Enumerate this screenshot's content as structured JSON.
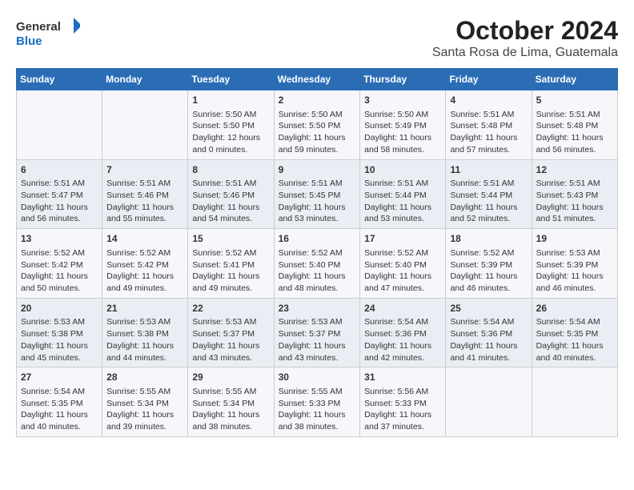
{
  "logo": {
    "line1": "General",
    "line2": "Blue"
  },
  "title": "October 2024",
  "subtitle": "Santa Rosa de Lima, Guatemala",
  "header_days": [
    "Sunday",
    "Monday",
    "Tuesday",
    "Wednesday",
    "Thursday",
    "Friday",
    "Saturday"
  ],
  "weeks": [
    [
      {
        "day": "",
        "content": ""
      },
      {
        "day": "",
        "content": ""
      },
      {
        "day": "1",
        "content": "Sunrise: 5:50 AM\nSunset: 5:50 PM\nDaylight: 12 hours\nand 0 minutes."
      },
      {
        "day": "2",
        "content": "Sunrise: 5:50 AM\nSunset: 5:50 PM\nDaylight: 11 hours\nand 59 minutes."
      },
      {
        "day": "3",
        "content": "Sunrise: 5:50 AM\nSunset: 5:49 PM\nDaylight: 11 hours\nand 58 minutes."
      },
      {
        "day": "4",
        "content": "Sunrise: 5:51 AM\nSunset: 5:48 PM\nDaylight: 11 hours\nand 57 minutes."
      },
      {
        "day": "5",
        "content": "Sunrise: 5:51 AM\nSunset: 5:48 PM\nDaylight: 11 hours\nand 56 minutes."
      }
    ],
    [
      {
        "day": "6",
        "content": "Sunrise: 5:51 AM\nSunset: 5:47 PM\nDaylight: 11 hours\nand 56 minutes."
      },
      {
        "day": "7",
        "content": "Sunrise: 5:51 AM\nSunset: 5:46 PM\nDaylight: 11 hours\nand 55 minutes."
      },
      {
        "day": "8",
        "content": "Sunrise: 5:51 AM\nSunset: 5:46 PM\nDaylight: 11 hours\nand 54 minutes."
      },
      {
        "day": "9",
        "content": "Sunrise: 5:51 AM\nSunset: 5:45 PM\nDaylight: 11 hours\nand 53 minutes."
      },
      {
        "day": "10",
        "content": "Sunrise: 5:51 AM\nSunset: 5:44 PM\nDaylight: 11 hours\nand 53 minutes."
      },
      {
        "day": "11",
        "content": "Sunrise: 5:51 AM\nSunset: 5:44 PM\nDaylight: 11 hours\nand 52 minutes."
      },
      {
        "day": "12",
        "content": "Sunrise: 5:51 AM\nSunset: 5:43 PM\nDaylight: 11 hours\nand 51 minutes."
      }
    ],
    [
      {
        "day": "13",
        "content": "Sunrise: 5:52 AM\nSunset: 5:42 PM\nDaylight: 11 hours\nand 50 minutes."
      },
      {
        "day": "14",
        "content": "Sunrise: 5:52 AM\nSunset: 5:42 PM\nDaylight: 11 hours\nand 49 minutes."
      },
      {
        "day": "15",
        "content": "Sunrise: 5:52 AM\nSunset: 5:41 PM\nDaylight: 11 hours\nand 49 minutes."
      },
      {
        "day": "16",
        "content": "Sunrise: 5:52 AM\nSunset: 5:40 PM\nDaylight: 11 hours\nand 48 minutes."
      },
      {
        "day": "17",
        "content": "Sunrise: 5:52 AM\nSunset: 5:40 PM\nDaylight: 11 hours\nand 47 minutes."
      },
      {
        "day": "18",
        "content": "Sunrise: 5:52 AM\nSunset: 5:39 PM\nDaylight: 11 hours\nand 46 minutes."
      },
      {
        "day": "19",
        "content": "Sunrise: 5:53 AM\nSunset: 5:39 PM\nDaylight: 11 hours\nand 46 minutes."
      }
    ],
    [
      {
        "day": "20",
        "content": "Sunrise: 5:53 AM\nSunset: 5:38 PM\nDaylight: 11 hours\nand 45 minutes."
      },
      {
        "day": "21",
        "content": "Sunrise: 5:53 AM\nSunset: 5:38 PM\nDaylight: 11 hours\nand 44 minutes."
      },
      {
        "day": "22",
        "content": "Sunrise: 5:53 AM\nSunset: 5:37 PM\nDaylight: 11 hours\nand 43 minutes."
      },
      {
        "day": "23",
        "content": "Sunrise: 5:53 AM\nSunset: 5:37 PM\nDaylight: 11 hours\nand 43 minutes."
      },
      {
        "day": "24",
        "content": "Sunrise: 5:54 AM\nSunset: 5:36 PM\nDaylight: 11 hours\nand 42 minutes."
      },
      {
        "day": "25",
        "content": "Sunrise: 5:54 AM\nSunset: 5:36 PM\nDaylight: 11 hours\nand 41 minutes."
      },
      {
        "day": "26",
        "content": "Sunrise: 5:54 AM\nSunset: 5:35 PM\nDaylight: 11 hours\nand 40 minutes."
      }
    ],
    [
      {
        "day": "27",
        "content": "Sunrise: 5:54 AM\nSunset: 5:35 PM\nDaylight: 11 hours\nand 40 minutes."
      },
      {
        "day": "28",
        "content": "Sunrise: 5:55 AM\nSunset: 5:34 PM\nDaylight: 11 hours\nand 39 minutes."
      },
      {
        "day": "29",
        "content": "Sunrise: 5:55 AM\nSunset: 5:34 PM\nDaylight: 11 hours\nand 38 minutes."
      },
      {
        "day": "30",
        "content": "Sunrise: 5:55 AM\nSunset: 5:33 PM\nDaylight: 11 hours\nand 38 minutes."
      },
      {
        "day": "31",
        "content": "Sunrise: 5:56 AM\nSunset: 5:33 PM\nDaylight: 11 hours\nand 37 minutes."
      },
      {
        "day": "",
        "content": ""
      },
      {
        "day": "",
        "content": ""
      }
    ]
  ]
}
